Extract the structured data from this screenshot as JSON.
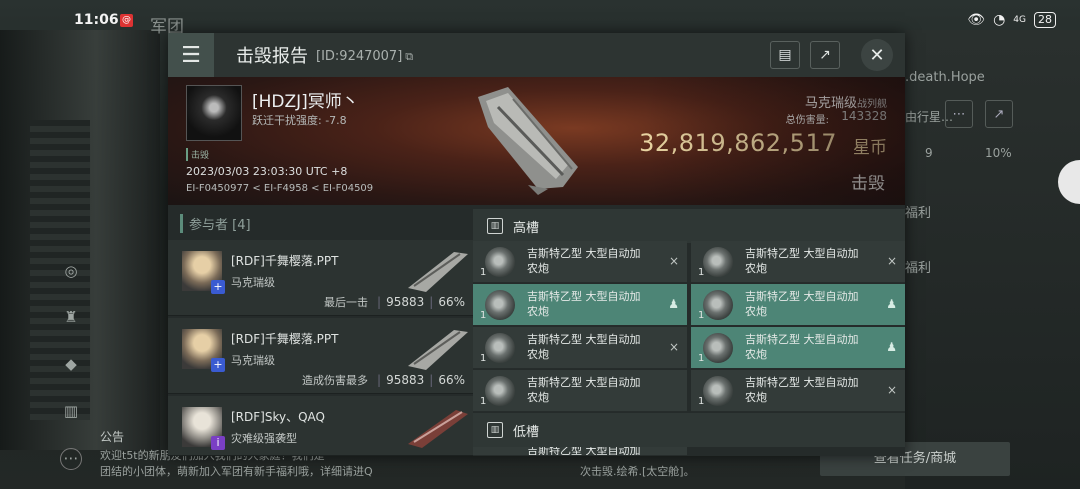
{
  "status_bar": {
    "time": "11:06",
    "notification_badge": "@",
    "battery": "28",
    "network": "4G"
  },
  "background": {
    "title": "军团",
    "right_text_1": ".death.Hope",
    "right_text_2": "由行星…",
    "right_num_1": "9",
    "right_num_2": "10%",
    "right_text_3": "福利",
    "right_text_4": "福利",
    "notice_title": "公告",
    "notice_line_1": "欢迎t5t的新朋友们加入我们的大家庭！我们是",
    "notice_line_2": "团结的小团体，萌新加入军团有新手福利哦，详细请进Q",
    "notice_line_3": "次击毁.绘希.[太空舱]。",
    "bottom_button": "查看任务/商城"
  },
  "header": {
    "title": "击毁报告",
    "kill_id": "[ID:9247007]"
  },
  "victim": {
    "name": "[HDZJ]冥师丶",
    "security": "跃迁干扰强度: -7.8",
    "tag": "击毁",
    "time": "2023/03/03 23:03:30 UTC +8",
    "location": "EI-F0450977 < EI-F4958 < EI-F04509",
    "ship_name": "马克瑞级",
    "ship_class": "战列舰",
    "damage_label": "总伤害量:",
    "damage_value": "143328",
    "isk_value": "32,819,862,517",
    "isk_unit": "星币",
    "result": "击毁"
  },
  "participants": {
    "header": "参与者 [4]",
    "rows": [
      {
        "name": "[RDF]千舞樱落.PPT",
        "ship": "马克瑞级",
        "label": "最后一击",
        "damage": "95883",
        "percent": "66%",
        "badge": "+"
      },
      {
        "name": "[RDF]千舞樱落.PPT",
        "ship": "马克瑞级",
        "label": "造成伤害最多",
        "damage": "95883",
        "percent": "66%",
        "badge": "+"
      },
      {
        "name": "[RDF]Sky、QAQ",
        "ship": "灾难级强袭型",
        "label": "",
        "damage": "",
        "percent": "",
        "badge": "i"
      }
    ]
  },
  "modules": {
    "high_slot_label": "高槽",
    "low_slot_label": "低槽",
    "high": [
      {
        "name": "吉斯特乙型 大型自动加农炮",
        "qty": "1",
        "state": "×"
      },
      {
        "name": "吉斯特乙型 大型自动加农炮",
        "qty": "1",
        "state": "×"
      },
      {
        "name": "吉斯特乙型 大型自动加农炮",
        "qty": "1",
        "state": "♟"
      },
      {
        "name": "吉斯特乙型 大型自动加农炮",
        "qty": "1",
        "state": "♟"
      },
      {
        "name": "吉斯特乙型 大型自动加农炮",
        "qty": "1",
        "state": "×"
      },
      {
        "name": "吉斯特乙型 大型自动加农炮",
        "qty": "1",
        "state": "♟"
      },
      {
        "name": "吉斯特乙型 大型自动加农炮",
        "qty": "1",
        "state": ""
      },
      {
        "name": "吉斯特乙型 大型自动加农炮",
        "qty": "1",
        "state": "×"
      }
    ],
    "low_partial": "吉斯特乙型 大型自动加农炮"
  },
  "colors": {
    "accent": "#4d8576",
    "isk": "#e8d3a1"
  }
}
